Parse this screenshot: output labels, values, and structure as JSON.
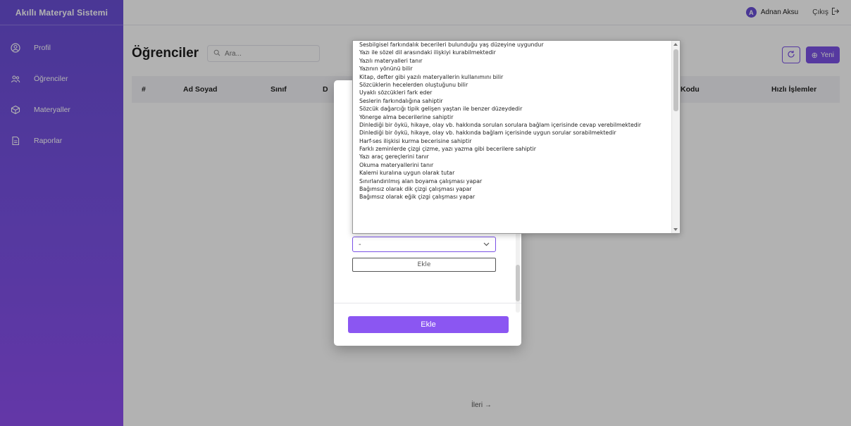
{
  "app": {
    "title": "Akıllı Materyal Sistemi"
  },
  "sidebar": {
    "items": [
      {
        "label": "Profil",
        "icon": "user-circle-icon"
      },
      {
        "label": "Öğrenciler",
        "icon": "students-icon"
      },
      {
        "label": "Materyaller",
        "icon": "box-icon"
      },
      {
        "label": "Raporlar",
        "icon": "report-icon"
      }
    ]
  },
  "topbar": {
    "user_initial": "A",
    "user_name": "Adnan Aksu",
    "logout_label": "Çıkış"
  },
  "page": {
    "title": "Öğrenciler",
    "search_placeholder": "Ara...",
    "new_label": "Yeni"
  },
  "table": {
    "headers": [
      "#",
      "Ad Soyad",
      "Sınıf",
      "D",
      "Kodu",
      "Hızlı İşlemler"
    ]
  },
  "pager": {
    "next_label": "İleri →"
  },
  "modal": {
    "select_value": "-",
    "add_small_label": "Ekle",
    "add_primary_label": "Ekle"
  },
  "dropdown": {
    "options": [
      "Sesbilgisel farkındalık becerileri bulunduğu yaş düzeyine uygundur",
      "Yazı ile sözel dil arasındaki ilişkiyi kurabilmektedir",
      "Yazılı materyalleri tanır",
      "Yazının yönünü bilir",
      "Kitap, defter gibi yazılı materyallerin kullanımını bilir",
      "Sözcüklerin hecelerden oluştuğunu bilir",
      "Uyaklı sözcükleri fark eder",
      "Seslerin farkındalığına sahiptir",
      "Sözcük dağarcığı tipik gelişen yaştan ile benzer düzeydedir",
      "Yönerge alma becerilerine sahiptir",
      "Dinlediği bir öykü, hikaye, olay vb. hakkında sorulan sorulara bağlam içerisinde cevap verebilmektedir",
      "Dinlediği bir öykü, hikaye, olay vb. hakkında bağlam içerisinde uygun sorular sorabilmektedir",
      "Harf-ses ilişkisi kurma becerisine sahiptir",
      "Farklı zeminlerde çizgi çizme, yazı yazma gibi becerilere sahiptir",
      "Yazı araç gereçlerini tanır",
      "Okuma materyallerini tanır",
      "Kalemi kuralına uygun olarak tutar",
      "Sınırlandırılmış alan boyama çalışması yapar",
      "Bağımsız olarak dik çizgi çalışması yapar",
      "Bağımsız olarak eğik çizgi çalışması yapar"
    ]
  },
  "colors": {
    "accent": "#7b52e6",
    "sidebar_top": "#6a4fd6",
    "sidebar_bottom": "#8f4ff0"
  }
}
